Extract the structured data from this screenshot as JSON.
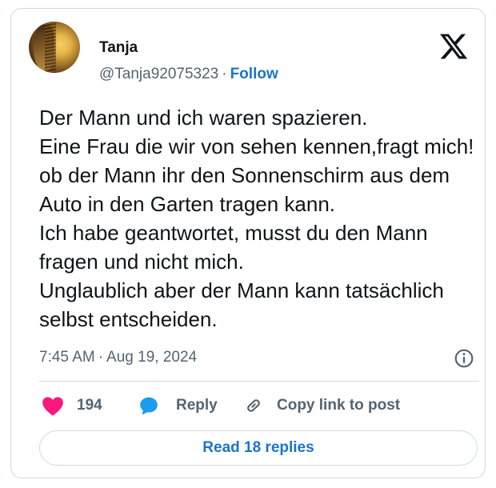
{
  "author": {
    "name": "Tanja",
    "handle": "@Tanja92075323",
    "separator": "·",
    "follow_label": "Follow"
  },
  "tweet": {
    "text": "Der Mann und ich waren spazieren.\nEine Frau die wir von sehen kennen,fragt mich! ob der Mann ihr den Sonnenschirm aus dem Auto in den Garten tragen kann.\nIch habe geantwortet, musst du den Mann fragen und nicht mich.\nUnglaublich aber der Mann kann tatsächlich selbst entscheiden.",
    "time": "7:45 AM",
    "separator": "·",
    "date": "Aug 19, 2024"
  },
  "actions": {
    "like_count": "194",
    "reply_label": "Reply",
    "copy_label": "Copy link to post"
  },
  "read_replies_label": "Read 18 replies",
  "icons": {
    "brand": "x-logo-icon",
    "info": "info-icon",
    "like": "heart-icon",
    "reply": "speech-bubble-icon",
    "copy": "link-icon"
  },
  "colors": {
    "text": "#0f1419",
    "secondary": "#536471",
    "accent": "#1d74c7",
    "like": "#f91880",
    "reply_icon": "#1d9bf0",
    "border": "#cfd9de"
  }
}
